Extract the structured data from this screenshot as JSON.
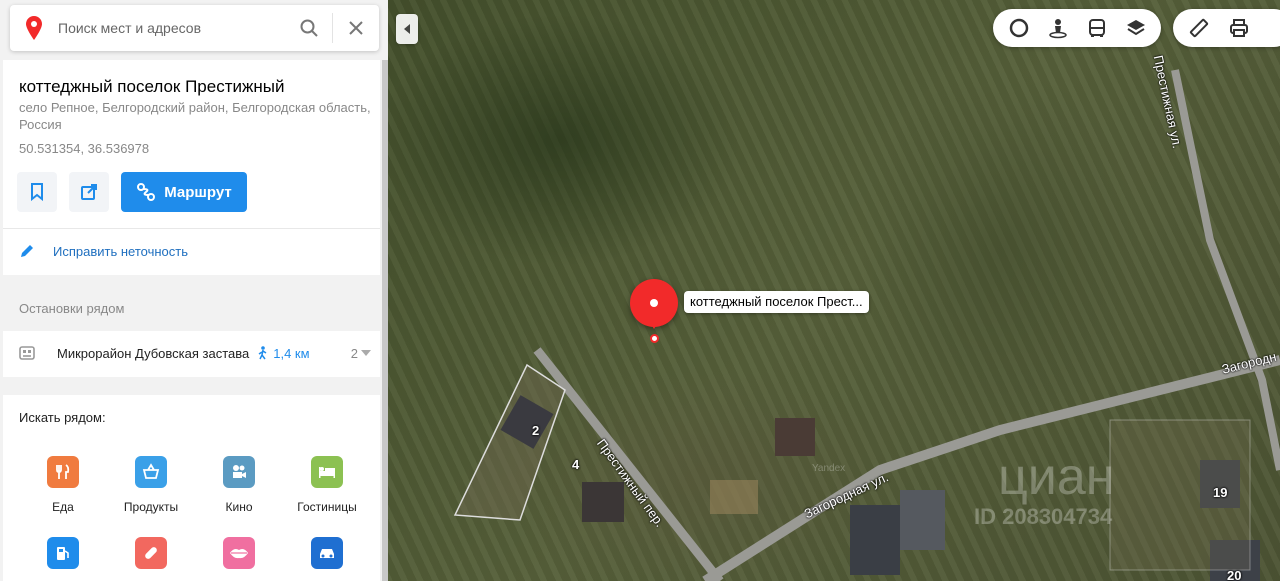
{
  "search": {
    "placeholder": "Поиск мест и адресов"
  },
  "place": {
    "title": "коттеджный поселок Престижный",
    "address": "село Репное, Белгородский район, Белгородская область, Россия",
    "coords": "50.531354, 36.536978",
    "route_label": "Маршрут",
    "fix_label": "Исправить неточность"
  },
  "stops": {
    "title": "Остановки рядом",
    "items": [
      {
        "name": "Микрорайон Дубовская застава",
        "distance": "1,4 км",
        "count": "2"
      }
    ]
  },
  "nearby": {
    "title": "Искать рядом:",
    "categories": [
      {
        "label": "Еда",
        "icon": "food-icon",
        "color": "#f07b3f"
      },
      {
        "label": "Продукты",
        "icon": "basket-icon",
        "color": "#3aa0e8"
      },
      {
        "label": "Кино",
        "icon": "camera-icon",
        "color": "#5b9bc2"
      },
      {
        "label": "Гостиницы",
        "icon": "bed-icon",
        "color": "#8cc152"
      },
      {
        "label": "",
        "icon": "fuel-icon",
        "color": "#1f8ceb"
      },
      {
        "label": "",
        "icon": "pill-icon",
        "color": "#f2685f"
      },
      {
        "label": "",
        "icon": "lips-icon",
        "color": "#f06fa0"
      },
      {
        "label": "",
        "icon": "car-icon",
        "color": "#1f6fd1"
      }
    ]
  },
  "map": {
    "placemark_label": "коттеджный поселок Прест...",
    "streets": {
      "prestizhnaya": "Престижная ул.",
      "zagorodnaya_right": "Загородн",
      "prestizhny_per": "Престижный пер.",
      "zagorodnaya": "Загородная ул."
    },
    "house_numbers": [
      "2",
      "4",
      "19",
      "20"
    ],
    "provider_label": "Yandex",
    "watermark_brand": "циан",
    "watermark_id": "ID 208304734"
  },
  "colors": {
    "accent": "#1f8ceb",
    "placemark": "#f22a2a"
  }
}
